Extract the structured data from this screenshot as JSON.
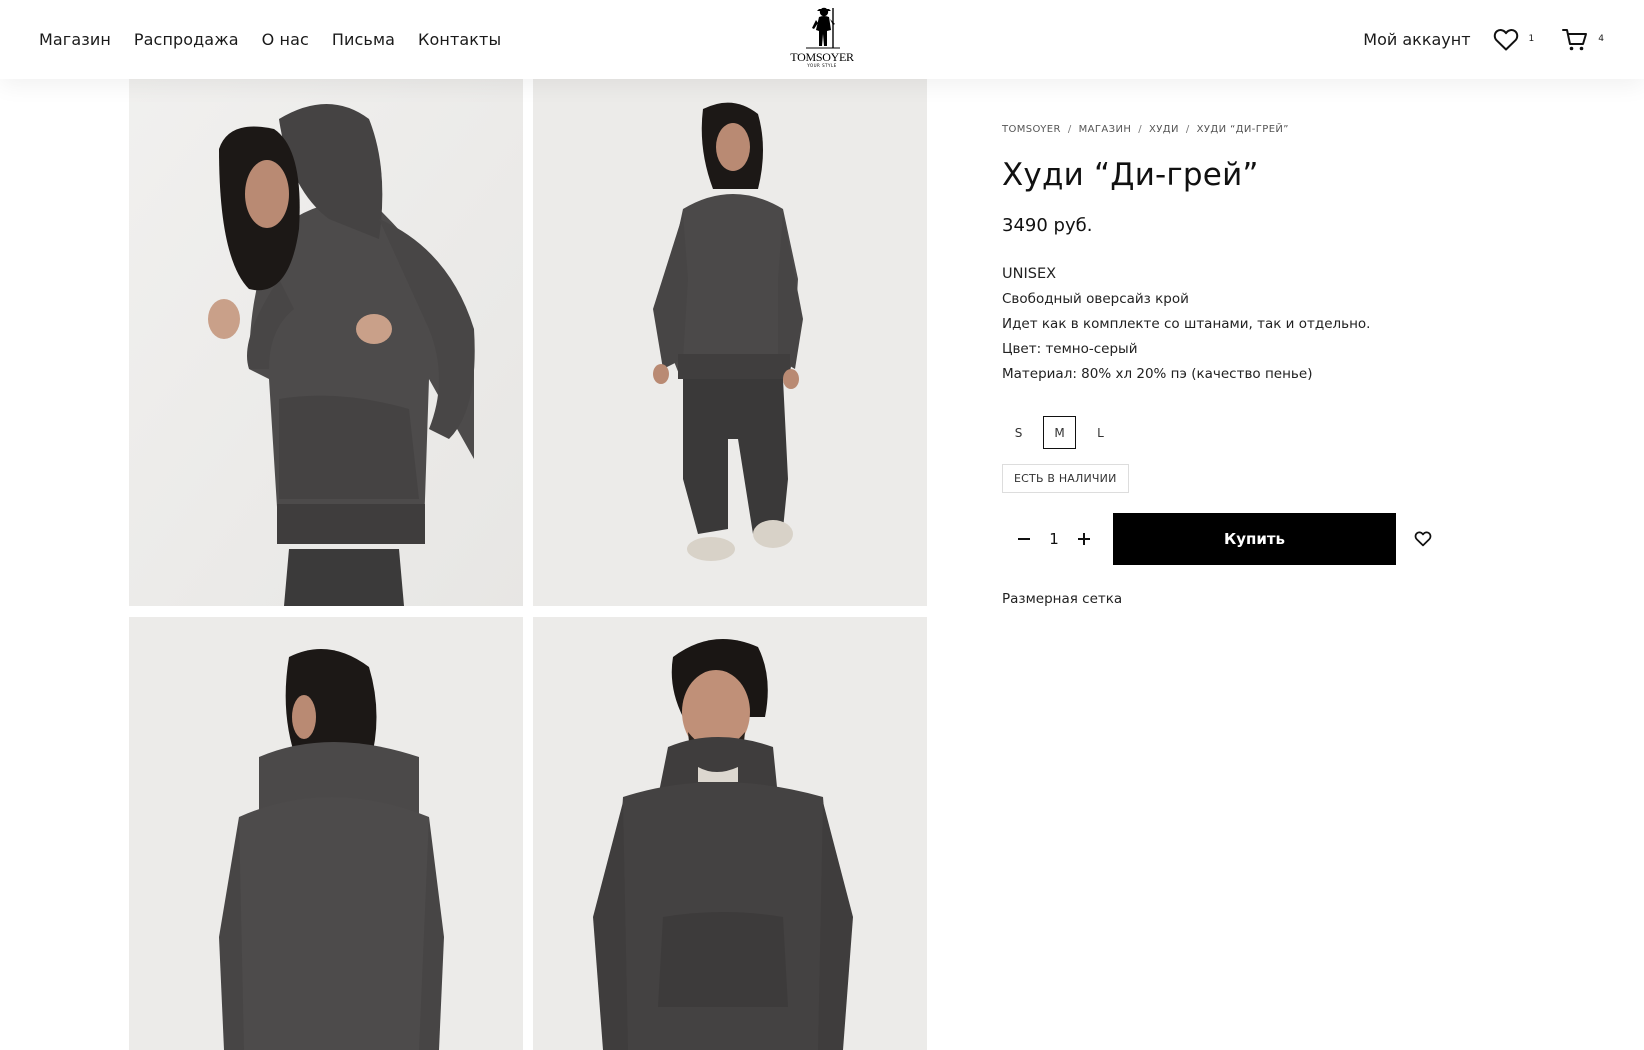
{
  "header": {
    "nav": [
      "Магазин",
      "Распродажа",
      "О нас",
      "Письма",
      "Контакты"
    ],
    "logo": {
      "name": "TOMSOYER",
      "tagline": "YOUR STYLE"
    },
    "account_label": "Мой аккаунт",
    "wishlist_count": "1",
    "cart_count": "4",
    "icons": [
      "heart-icon",
      "cart-icon"
    ]
  },
  "breadcrumb": [
    "TOMSOYER",
    "МАГАЗИН",
    "ХУДИ",
    "ХУДИ “ДИ-ГРЕЙ”"
  ],
  "product": {
    "title": "Худи “Ди-грей”",
    "price": "3490 руб.",
    "description": [
      "UNISEX",
      "Свободный оверсайз крой",
      "Идет как в комплекте со штанами, так и отдельно.",
      "Цвет: темно-серый",
      "Материал: 80% хл 20% пэ (качество пенье)"
    ],
    "sizes": [
      "S",
      "M",
      "L"
    ],
    "selected_size": "M",
    "stock_label": "ЕСТЬ В НАЛИЧИИ",
    "quantity": "1",
    "buy_label": "Купить",
    "size_chart_label": "Размерная сетка"
  },
  "colors": {
    "accent": "#000000",
    "photo_bg": "#ececea",
    "hoodie": "#4a4848"
  }
}
